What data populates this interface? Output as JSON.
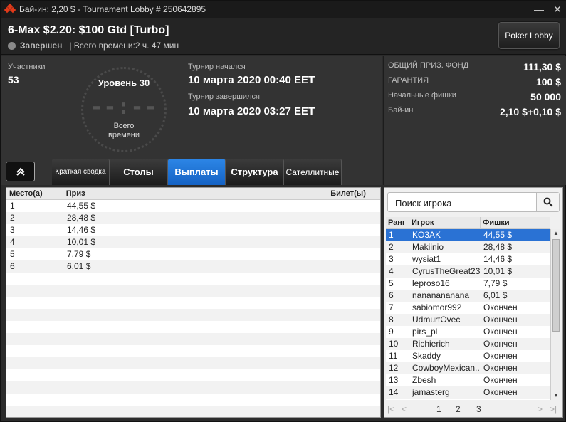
{
  "window": {
    "title": "Бай-ин: 2,20 $ - Tournament Lobby # 250642895",
    "min_icon": "minimize-icon",
    "close_icon": "close-icon"
  },
  "header": {
    "tournament_name": "6-Max $2.20: $100 Gtd [Turbo]",
    "status": "Завершен",
    "total_time": "| Всего времени:2 ч. 47 мин",
    "lobby_button": "Poker Lobby"
  },
  "info": {
    "entrants_label": "Участники",
    "entrants_value": "53",
    "level": "Уровень 30",
    "clock_digits": "--:--",
    "clock_caption_1": "Всего",
    "clock_caption_2": "времени",
    "started_label": "Турнир начался",
    "started_value": "10 марта 2020  00:40 EET",
    "ended_label": "Турнир завершился",
    "ended_value": "10 марта 2020  03:27 EET"
  },
  "prize": {
    "pool_label": "ОБЩИЙ ПРИЗ. ФОНД",
    "pool_value": "111,30 $",
    "guarantee_label": "ГАРАНТИЯ",
    "guarantee_value": "100 $",
    "chips_label": "Начальные фишки",
    "chips_value": "50 000",
    "buyin_label": "Бай-ин",
    "buyin_value": "2,10 $+0,10 $"
  },
  "tabs": [
    {
      "label": "Краткая сводка",
      "active": false
    },
    {
      "label": "Столы",
      "active": false
    },
    {
      "label": "Выплаты",
      "active": true
    },
    {
      "label": "Структура",
      "active": false
    },
    {
      "label": "Сателлитные",
      "active": false
    }
  ],
  "payouts": {
    "headers": [
      "Место(а)",
      "Приз",
      "Билет(ы)"
    ],
    "rows": [
      {
        "place": "1",
        "prize": "44,55 $"
      },
      {
        "place": "2",
        "prize": "28,48 $"
      },
      {
        "place": "3",
        "prize": "14,46 $"
      },
      {
        "place": "4",
        "prize": "10,01 $"
      },
      {
        "place": "5",
        "prize": "7,79 $"
      },
      {
        "place": "6",
        "prize": "6,01 $"
      }
    ]
  },
  "players": {
    "search_placeholder": "Поиск игрока",
    "headers": [
      "Ранг",
      "Игрок",
      "Фишки"
    ],
    "rows": [
      {
        "rank": "1",
        "name": "KO3AK",
        "chips": "44,55 $"
      },
      {
        "rank": "2",
        "name": "Makiinio",
        "chips": "28,48 $"
      },
      {
        "rank": "3",
        "name": "wysiat1",
        "chips": "14,46 $"
      },
      {
        "rank": "4",
        "name": "CyrusTheGreat23",
        "chips": "10,01 $"
      },
      {
        "rank": "5",
        "name": "leproso16",
        "chips": "7,79 $"
      },
      {
        "rank": "6",
        "name": "nananananana",
        "chips": "6,01 $"
      },
      {
        "rank": "7",
        "name": "sabiomor992",
        "chips": "Окончен"
      },
      {
        "rank": "8",
        "name": "UdmurtOvec",
        "chips": "Окончен"
      },
      {
        "rank": "9",
        "name": "pirs_pl",
        "chips": "Окончен"
      },
      {
        "rank": "10",
        "name": "Richierich",
        "chips": "Окончен"
      },
      {
        "rank": "11",
        "name": "Skaddy",
        "chips": "Окончен"
      },
      {
        "rank": "12",
        "name": "CowboyMexican..",
        "chips": "Окончен"
      },
      {
        "rank": "13",
        "name": "Zbesh",
        "chips": "Окончен"
      },
      {
        "rank": "14",
        "name": "jamasterg",
        "chips": "Окончен"
      }
    ],
    "pages": [
      "1",
      "2",
      "3"
    ]
  }
}
